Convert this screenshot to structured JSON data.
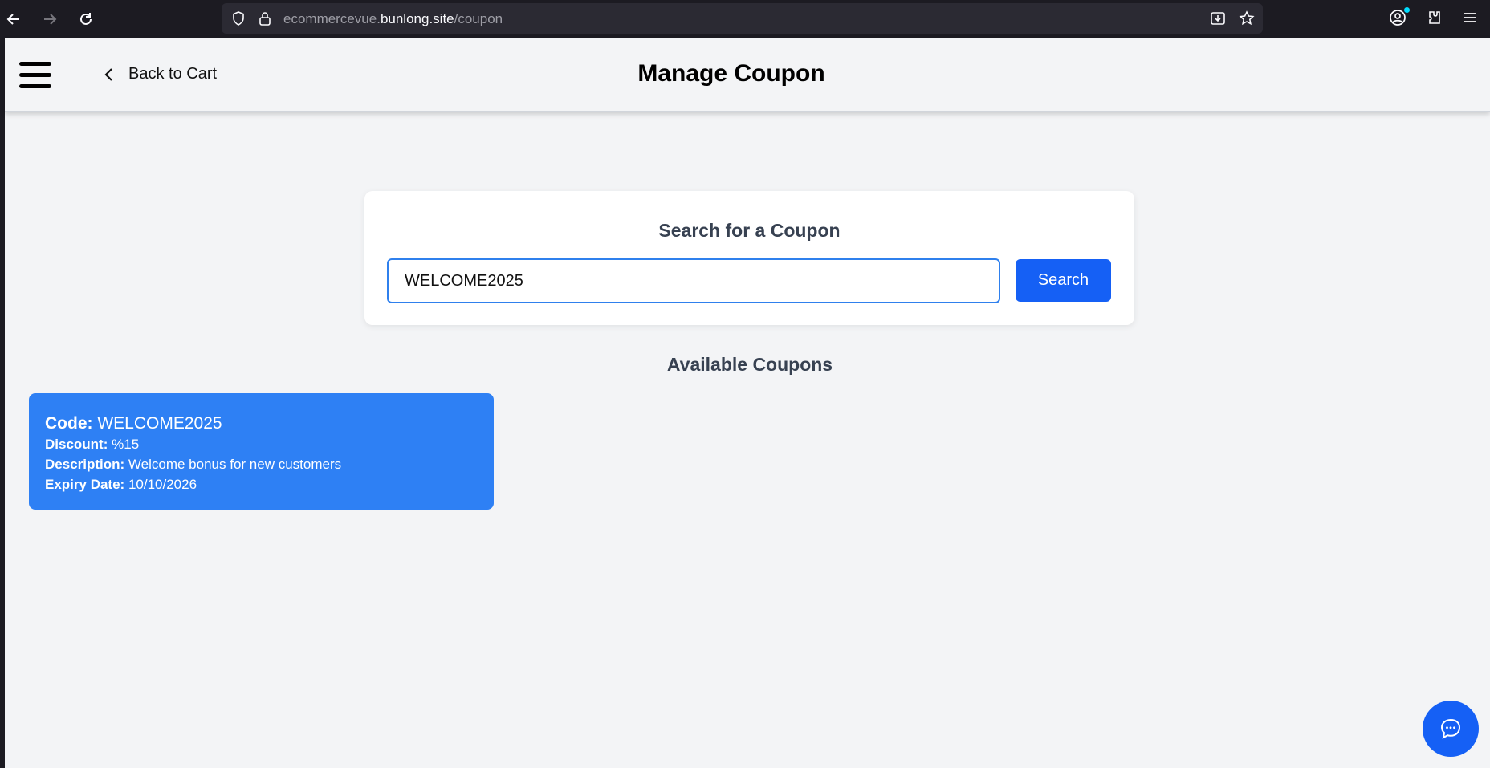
{
  "browser": {
    "url_prefix": "ecommercevue.",
    "url_host": "bunlong.site",
    "url_path": "/coupon"
  },
  "header": {
    "back_label": "Back to Cart",
    "title": "Manage Coupon"
  },
  "search": {
    "title": "Search for a Coupon",
    "input_value": "WELCOME2025",
    "button_label": "Search"
  },
  "available": {
    "title": "Available Coupons",
    "coupons": [
      {
        "code_label": "Code:",
        "code": "WELCOME2025",
        "discount_label": "Discount:",
        "discount": "%15",
        "description_label": "Description:",
        "description": "Welcome bonus for new customers",
        "expiry_label": "Expiry Date:",
        "expiry": "10/10/2026"
      }
    ]
  },
  "colors": {
    "accent": "#1560f5",
    "coupon_card": "#2e80f4",
    "background": "#f3f4f6"
  }
}
